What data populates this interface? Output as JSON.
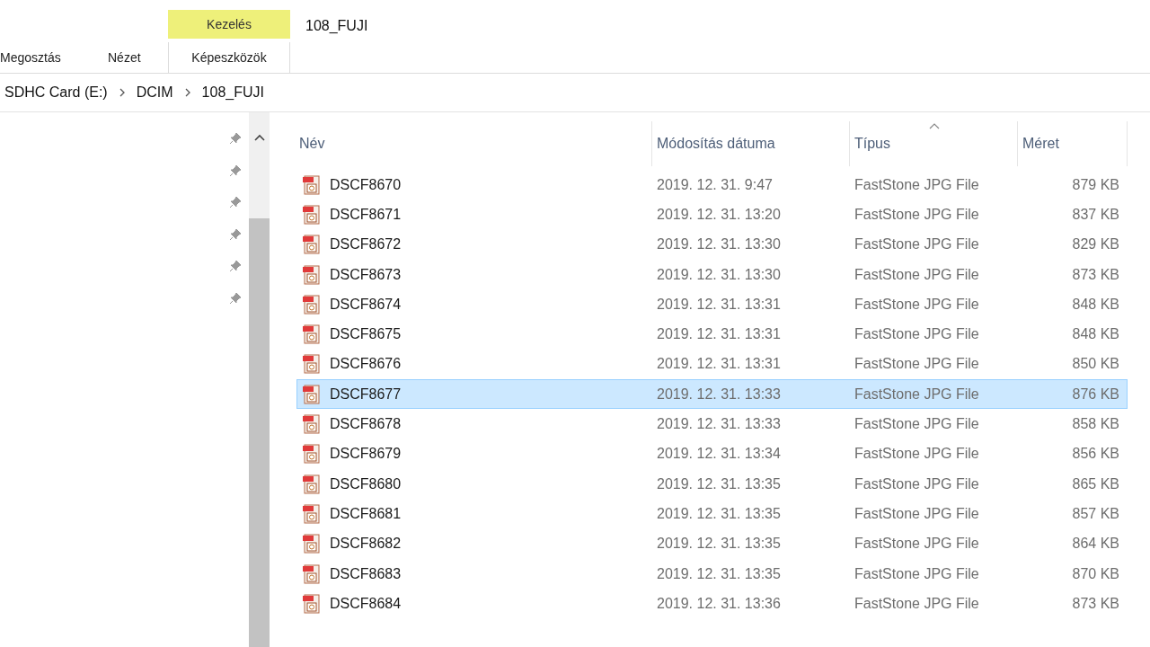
{
  "ribbon": {
    "tabs": [
      {
        "label": "Megosztás"
      },
      {
        "label": "Nézet"
      }
    ],
    "context_group": {
      "label": "Kezelés",
      "tab": "Képeszközök"
    },
    "title": "108_FUJI"
  },
  "breadcrumb": [
    "SDHC Card (E:)",
    "DCIM",
    "108_FUJI"
  ],
  "file_list": {
    "columns": [
      {
        "label": "Név",
        "sorted": false
      },
      {
        "label": "Módosítás dátuma",
        "sorted": false
      },
      {
        "label": "Típus",
        "sorted": true
      },
      {
        "label": "Méret",
        "sorted": false
      }
    ],
    "rows": [
      {
        "name": "DSCF8670",
        "modified": "2019. 12. 31. 9:47",
        "type": "FastStone JPG File",
        "size": "879 KB",
        "selected": false
      },
      {
        "name": "DSCF8671",
        "modified": "2019. 12. 31. 13:20",
        "type": "FastStone JPG File",
        "size": "837 KB",
        "selected": false
      },
      {
        "name": "DSCF8672",
        "modified": "2019. 12. 31. 13:30",
        "type": "FastStone JPG File",
        "size": "829 KB",
        "selected": false
      },
      {
        "name": "DSCF8673",
        "modified": "2019. 12. 31. 13:30",
        "type": "FastStone JPG File",
        "size": "873 KB",
        "selected": false
      },
      {
        "name": "DSCF8674",
        "modified": "2019. 12. 31. 13:31",
        "type": "FastStone JPG File",
        "size": "848 KB",
        "selected": false
      },
      {
        "name": "DSCF8675",
        "modified": "2019. 12. 31. 13:31",
        "type": "FastStone JPG File",
        "size": "848 KB",
        "selected": false
      },
      {
        "name": "DSCF8676",
        "modified": "2019. 12. 31. 13:31",
        "type": "FastStone JPG File",
        "size": "850 KB",
        "selected": false
      },
      {
        "name": "DSCF8677",
        "modified": "2019. 12. 31. 13:33",
        "type": "FastStone JPG File",
        "size": "876 KB",
        "selected": true
      },
      {
        "name": "DSCF8678",
        "modified": "2019. 12. 31. 13:33",
        "type": "FastStone JPG File",
        "size": "858 KB",
        "selected": false
      },
      {
        "name": "DSCF8679",
        "modified": "2019. 12. 31. 13:34",
        "type": "FastStone JPG File",
        "size": "856 KB",
        "selected": false
      },
      {
        "name": "DSCF8680",
        "modified": "2019. 12. 31. 13:35",
        "type": "FastStone JPG File",
        "size": "865 KB",
        "selected": false
      },
      {
        "name": "DSCF8681",
        "modified": "2019. 12. 31. 13:35",
        "type": "FastStone JPG File",
        "size": "857 KB",
        "selected": false
      },
      {
        "name": "DSCF8682",
        "modified": "2019. 12. 31. 13:35",
        "type": "FastStone JPG File",
        "size": "864 KB",
        "selected": false
      },
      {
        "name": "DSCF8683",
        "modified": "2019. 12. 31. 13:35",
        "type": "FastStone JPG File",
        "size": "870 KB",
        "selected": false
      },
      {
        "name": "DSCF8684",
        "modified": "2019. 12. 31. 13:36",
        "type": "FastStone JPG File",
        "size": "873 KB",
        "selected": false
      }
    ]
  }
}
